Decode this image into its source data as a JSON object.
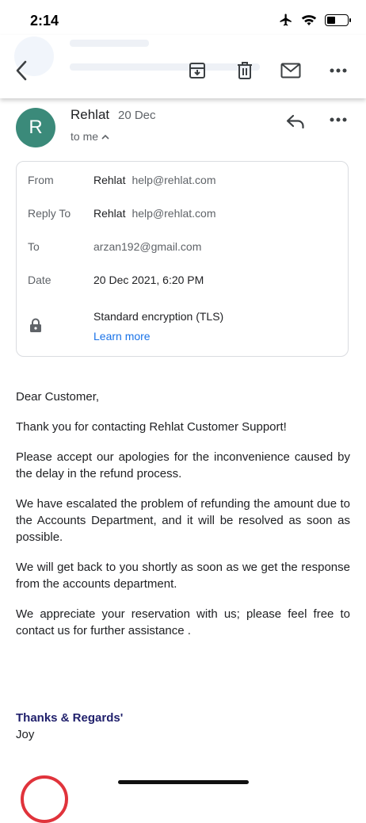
{
  "status_bar": {
    "time": "2:14",
    "battery_level": 0.45
  },
  "toolbar": {
    "icons": [
      "back-icon",
      "archive-icon",
      "delete-icon",
      "mail-icon",
      "more-icon"
    ]
  },
  "message": {
    "avatar_letter": "R",
    "avatar_color": "#3b8a7a",
    "sender": "Rehlat",
    "date": "20 Dec",
    "to_label": "to me",
    "details": {
      "from_label": "From",
      "from_name": "Rehlat",
      "from_email": "help@rehlat.com",
      "reply_to_label": "Reply To",
      "reply_to_name": "Rehlat",
      "reply_to_email": "help@rehlat.com",
      "to_label": "To",
      "to_email": "arzan192@gmail.com",
      "date_label": "Date",
      "date_value": "20 Dec 2021, 6:20 PM",
      "encryption": "Standard encryption (TLS)",
      "learn_more": "Learn more"
    },
    "body": [
      "Dear Customer,",
      "Thank you for contacting Rehlat Customer Support!",
      "Please accept our apologies for the inconvenience caused by the delay in the refund process.",
      "We have escalated the problem of refunding the amount due to the Accounts Department, and it will be resolved as soon as possible.",
      "We will get back to you shortly as soon as we get the response from the accounts department.",
      "We appreciate your reservation with us; please feel free to contact us for further assistance ."
    ],
    "signature_title": "Thanks & Regards'",
    "signature_name": "Joy"
  },
  "colors": {
    "link": "#1a73e8",
    "signature": "#1f1f6b",
    "logo_red": "#e0333b"
  }
}
